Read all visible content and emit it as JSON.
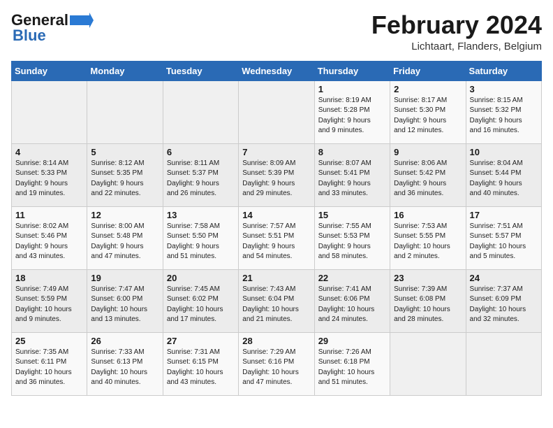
{
  "header": {
    "logo_line1": "General",
    "logo_line2": "Blue",
    "title": "February 2024",
    "subtitle": "Lichtaart, Flanders, Belgium"
  },
  "weekdays": [
    "Sunday",
    "Monday",
    "Tuesday",
    "Wednesday",
    "Thursday",
    "Friday",
    "Saturday"
  ],
  "rows": [
    [
      {
        "num": "",
        "info": ""
      },
      {
        "num": "",
        "info": ""
      },
      {
        "num": "",
        "info": ""
      },
      {
        "num": "",
        "info": ""
      },
      {
        "num": "1",
        "info": "Sunrise: 8:19 AM\nSunset: 5:28 PM\nDaylight: 9 hours\nand 9 minutes."
      },
      {
        "num": "2",
        "info": "Sunrise: 8:17 AM\nSunset: 5:30 PM\nDaylight: 9 hours\nand 12 minutes."
      },
      {
        "num": "3",
        "info": "Sunrise: 8:15 AM\nSunset: 5:32 PM\nDaylight: 9 hours\nand 16 minutes."
      }
    ],
    [
      {
        "num": "4",
        "info": "Sunrise: 8:14 AM\nSunset: 5:33 PM\nDaylight: 9 hours\nand 19 minutes."
      },
      {
        "num": "5",
        "info": "Sunrise: 8:12 AM\nSunset: 5:35 PM\nDaylight: 9 hours\nand 22 minutes."
      },
      {
        "num": "6",
        "info": "Sunrise: 8:11 AM\nSunset: 5:37 PM\nDaylight: 9 hours\nand 26 minutes."
      },
      {
        "num": "7",
        "info": "Sunrise: 8:09 AM\nSunset: 5:39 PM\nDaylight: 9 hours\nand 29 minutes."
      },
      {
        "num": "8",
        "info": "Sunrise: 8:07 AM\nSunset: 5:41 PM\nDaylight: 9 hours\nand 33 minutes."
      },
      {
        "num": "9",
        "info": "Sunrise: 8:06 AM\nSunset: 5:42 PM\nDaylight: 9 hours\nand 36 minutes."
      },
      {
        "num": "10",
        "info": "Sunrise: 8:04 AM\nSunset: 5:44 PM\nDaylight: 9 hours\nand 40 minutes."
      }
    ],
    [
      {
        "num": "11",
        "info": "Sunrise: 8:02 AM\nSunset: 5:46 PM\nDaylight: 9 hours\nand 43 minutes."
      },
      {
        "num": "12",
        "info": "Sunrise: 8:00 AM\nSunset: 5:48 PM\nDaylight: 9 hours\nand 47 minutes."
      },
      {
        "num": "13",
        "info": "Sunrise: 7:58 AM\nSunset: 5:50 PM\nDaylight: 9 hours\nand 51 minutes."
      },
      {
        "num": "14",
        "info": "Sunrise: 7:57 AM\nSunset: 5:51 PM\nDaylight: 9 hours\nand 54 minutes."
      },
      {
        "num": "15",
        "info": "Sunrise: 7:55 AM\nSunset: 5:53 PM\nDaylight: 9 hours\nand 58 minutes."
      },
      {
        "num": "16",
        "info": "Sunrise: 7:53 AM\nSunset: 5:55 PM\nDaylight: 10 hours\nand 2 minutes."
      },
      {
        "num": "17",
        "info": "Sunrise: 7:51 AM\nSunset: 5:57 PM\nDaylight: 10 hours\nand 5 minutes."
      }
    ],
    [
      {
        "num": "18",
        "info": "Sunrise: 7:49 AM\nSunset: 5:59 PM\nDaylight: 10 hours\nand 9 minutes."
      },
      {
        "num": "19",
        "info": "Sunrise: 7:47 AM\nSunset: 6:00 PM\nDaylight: 10 hours\nand 13 minutes."
      },
      {
        "num": "20",
        "info": "Sunrise: 7:45 AM\nSunset: 6:02 PM\nDaylight: 10 hours\nand 17 minutes."
      },
      {
        "num": "21",
        "info": "Sunrise: 7:43 AM\nSunset: 6:04 PM\nDaylight: 10 hours\nand 21 minutes."
      },
      {
        "num": "22",
        "info": "Sunrise: 7:41 AM\nSunset: 6:06 PM\nDaylight: 10 hours\nand 24 minutes."
      },
      {
        "num": "23",
        "info": "Sunrise: 7:39 AM\nSunset: 6:08 PM\nDaylight: 10 hours\nand 28 minutes."
      },
      {
        "num": "24",
        "info": "Sunrise: 7:37 AM\nSunset: 6:09 PM\nDaylight: 10 hours\nand 32 minutes."
      }
    ],
    [
      {
        "num": "25",
        "info": "Sunrise: 7:35 AM\nSunset: 6:11 PM\nDaylight: 10 hours\nand 36 minutes."
      },
      {
        "num": "26",
        "info": "Sunrise: 7:33 AM\nSunset: 6:13 PM\nDaylight: 10 hours\nand 40 minutes."
      },
      {
        "num": "27",
        "info": "Sunrise: 7:31 AM\nSunset: 6:15 PM\nDaylight: 10 hours\nand 43 minutes."
      },
      {
        "num": "28",
        "info": "Sunrise: 7:29 AM\nSunset: 6:16 PM\nDaylight: 10 hours\nand 47 minutes."
      },
      {
        "num": "29",
        "info": "Sunrise: 7:26 AM\nSunset: 6:18 PM\nDaylight: 10 hours\nand 51 minutes."
      },
      {
        "num": "",
        "info": ""
      },
      {
        "num": "",
        "info": ""
      }
    ]
  ]
}
